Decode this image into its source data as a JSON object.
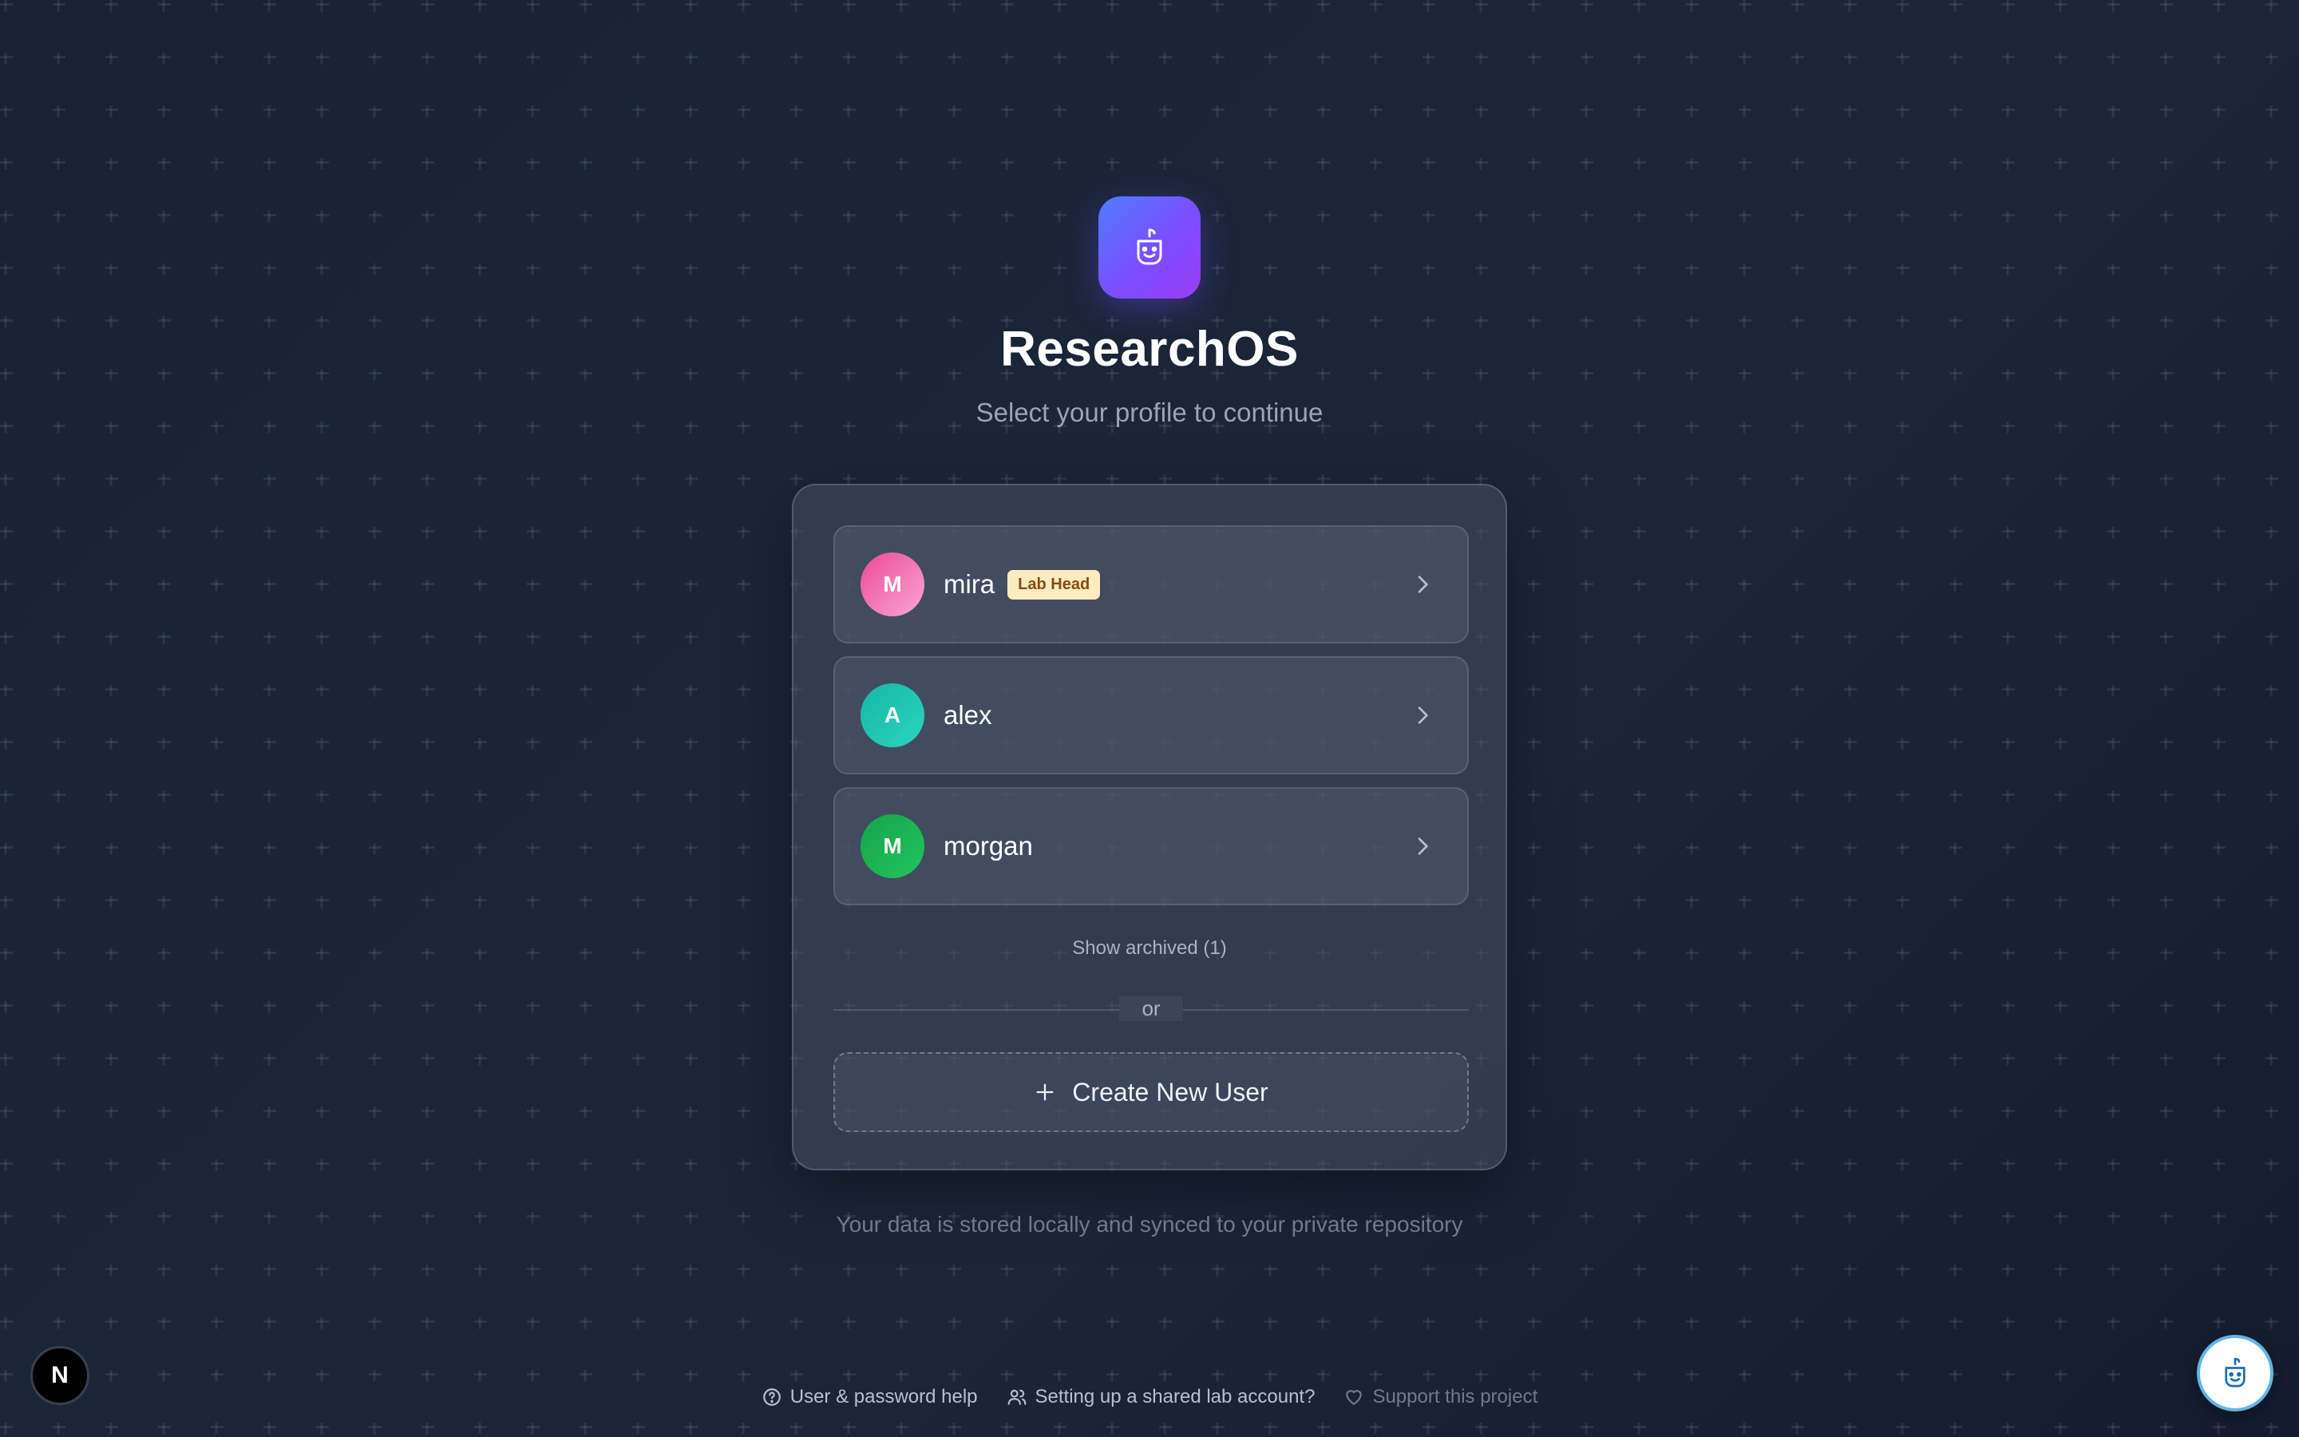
{
  "app": {
    "title": "ResearchOS",
    "subtitle": "Select your profile to continue"
  },
  "profiles": [
    {
      "initial": "M",
      "name": "mira",
      "badge": "Lab Head",
      "color_from": "#ec4899",
      "color_to": "#f472b6"
    },
    {
      "initial": "A",
      "name": "alex",
      "badge": null,
      "color_from": "#14b8a6",
      "color_to": "#2dd4bf"
    },
    {
      "initial": "M",
      "name": "morgan",
      "badge": null,
      "color_from": "#16a34a",
      "color_to": "#22c55e"
    }
  ],
  "archived_label": "Show archived (1)",
  "divider_text": "or",
  "create_user_label": "Create New User",
  "footer_note": "Your data is stored locally and synced to your private repository",
  "bottom_links": {
    "help": "User & password help",
    "shared": "Setting up a shared lab account?",
    "support": "Support this project"
  },
  "corner_badge": "N",
  "colors": {
    "accent_from": "#4f7cff",
    "accent_to": "#9b3cf5",
    "badge_bg": "#fcecc0",
    "badge_text": "#8a4a10"
  },
  "icons": {
    "logo": "robot-face-icon",
    "chevron": "chevron-right-icon",
    "plus": "plus-icon",
    "help": "question-circle-icon",
    "users": "users-icon",
    "heart": "heart-icon",
    "assistant": "robot-face-icon"
  }
}
